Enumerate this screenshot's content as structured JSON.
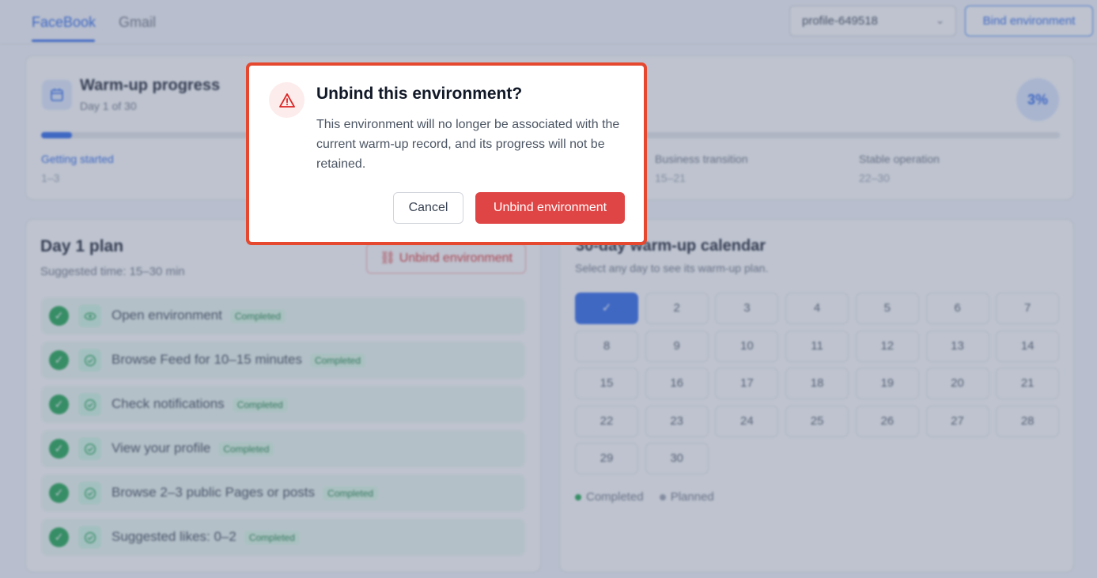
{
  "tabs": [
    {
      "label": "FaceBook",
      "active": true
    },
    {
      "label": "Gmail",
      "active": false
    }
  ],
  "header": {
    "profile_select_value": "profile-649518",
    "bind_button_label": "Bind environment"
  },
  "progress": {
    "title": "Warm-up progress",
    "subtitle": "Day 1 of 30",
    "percent_label": "3%",
    "percent_value": 0.03,
    "phases": [
      {
        "name": "Getting started",
        "range": "1–3",
        "active": true
      },
      {
        "name": "Business transition",
        "range": "15–21",
        "active": false
      },
      {
        "name": "Stable operation",
        "range": "22–30",
        "active": false
      }
    ]
  },
  "plan": {
    "title": "Day 1 plan",
    "subtitle": "Suggested time: 15–30 min",
    "unbind_label": "Unbind environment",
    "tasks": [
      {
        "label": "Open environment",
        "status": "Completed",
        "icon": "eye-icon"
      },
      {
        "label": "Browse Feed for 10–15 minutes",
        "status": "Completed",
        "icon": "circle-check-icon"
      },
      {
        "label": "Check notifications",
        "status": "Completed",
        "icon": "circle-check-icon"
      },
      {
        "label": "View your profile",
        "status": "Completed",
        "icon": "circle-check-icon"
      },
      {
        "label": "Browse 2–3 public Pages or posts",
        "status": "Completed",
        "icon": "circle-check-icon"
      },
      {
        "label": "Suggested likes: 0–2",
        "status": "Completed",
        "icon": "circle-check-icon"
      }
    ]
  },
  "calendar": {
    "title": "30-day warm-up calendar",
    "subtitle": "Select any day to see its warm-up plan.",
    "selected_day": 1,
    "selected_mark": "✓",
    "days": [
      "1",
      "2",
      "3",
      "4",
      "5",
      "6",
      "7",
      "8",
      "9",
      "10",
      "11",
      "12",
      "13",
      "14",
      "15",
      "16",
      "17",
      "18",
      "19",
      "20",
      "21",
      "22",
      "23",
      "24",
      "25",
      "26",
      "27",
      "28",
      "29",
      "30"
    ],
    "legend": [
      {
        "label": "Completed",
        "color": "#16a34a"
      },
      {
        "label": "Planned",
        "color": "#9ca3af"
      }
    ]
  },
  "modal": {
    "title": "Unbind this environment?",
    "body": "This environment will no longer be associated with the current warm-up record, and its progress will not be retained.",
    "cancel_label": "Cancel",
    "confirm_label": "Unbind environment",
    "icon": "warning-icon"
  },
  "colors": {
    "accent": "#2563eb",
    "danger": "#e04545",
    "highlight_frame": "#e5482f",
    "success": "#16a34a"
  }
}
